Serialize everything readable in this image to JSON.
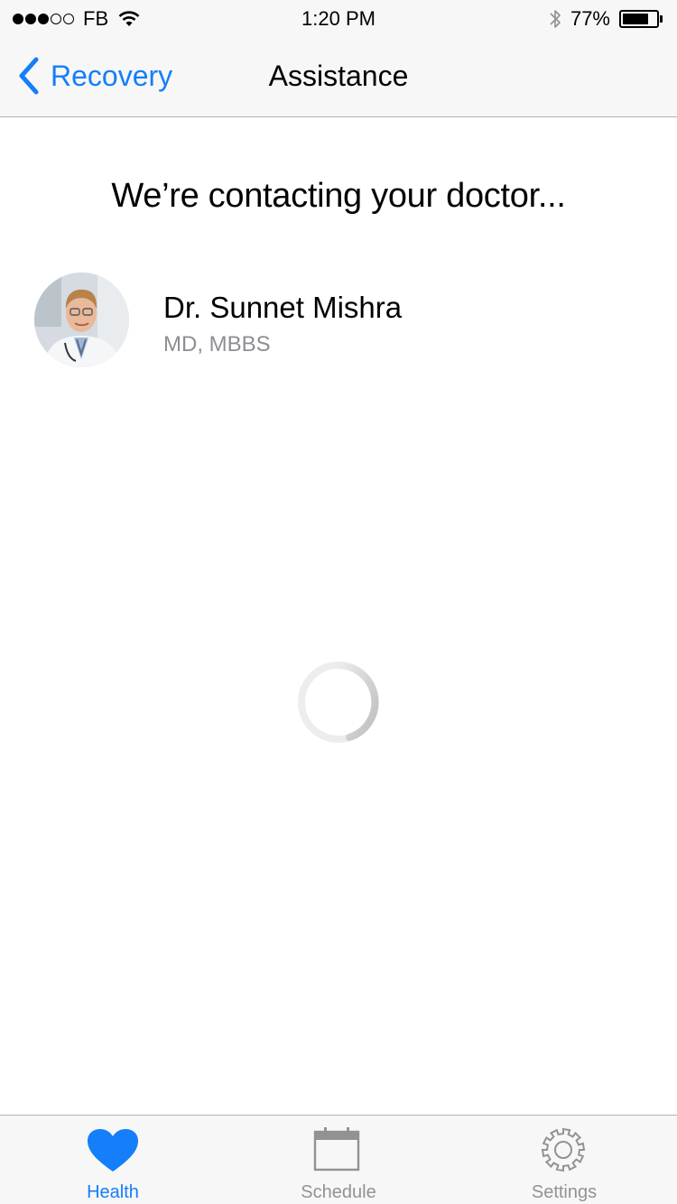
{
  "status_bar": {
    "carrier": "FB",
    "time": "1:20 PM",
    "battery": "77%",
    "battery_level": 0.77
  },
  "nav": {
    "back_label": "Recovery",
    "title": "Assistance"
  },
  "main": {
    "heading": "We’re contacting your doctor...",
    "doctor": {
      "name": "Dr. Sunnet Mishra",
      "credentials": "MD, MBBS"
    }
  },
  "tabs": [
    {
      "label": "Health",
      "icon": "heart-icon",
      "active": true
    },
    {
      "label": "Schedule",
      "icon": "calendar-icon",
      "active": false
    },
    {
      "label": "Settings",
      "icon": "gear-icon",
      "active": false
    }
  ],
  "colors": {
    "accent": "#147efb",
    "inactive": "#929292",
    "bar_background": "#f7f7f7"
  }
}
